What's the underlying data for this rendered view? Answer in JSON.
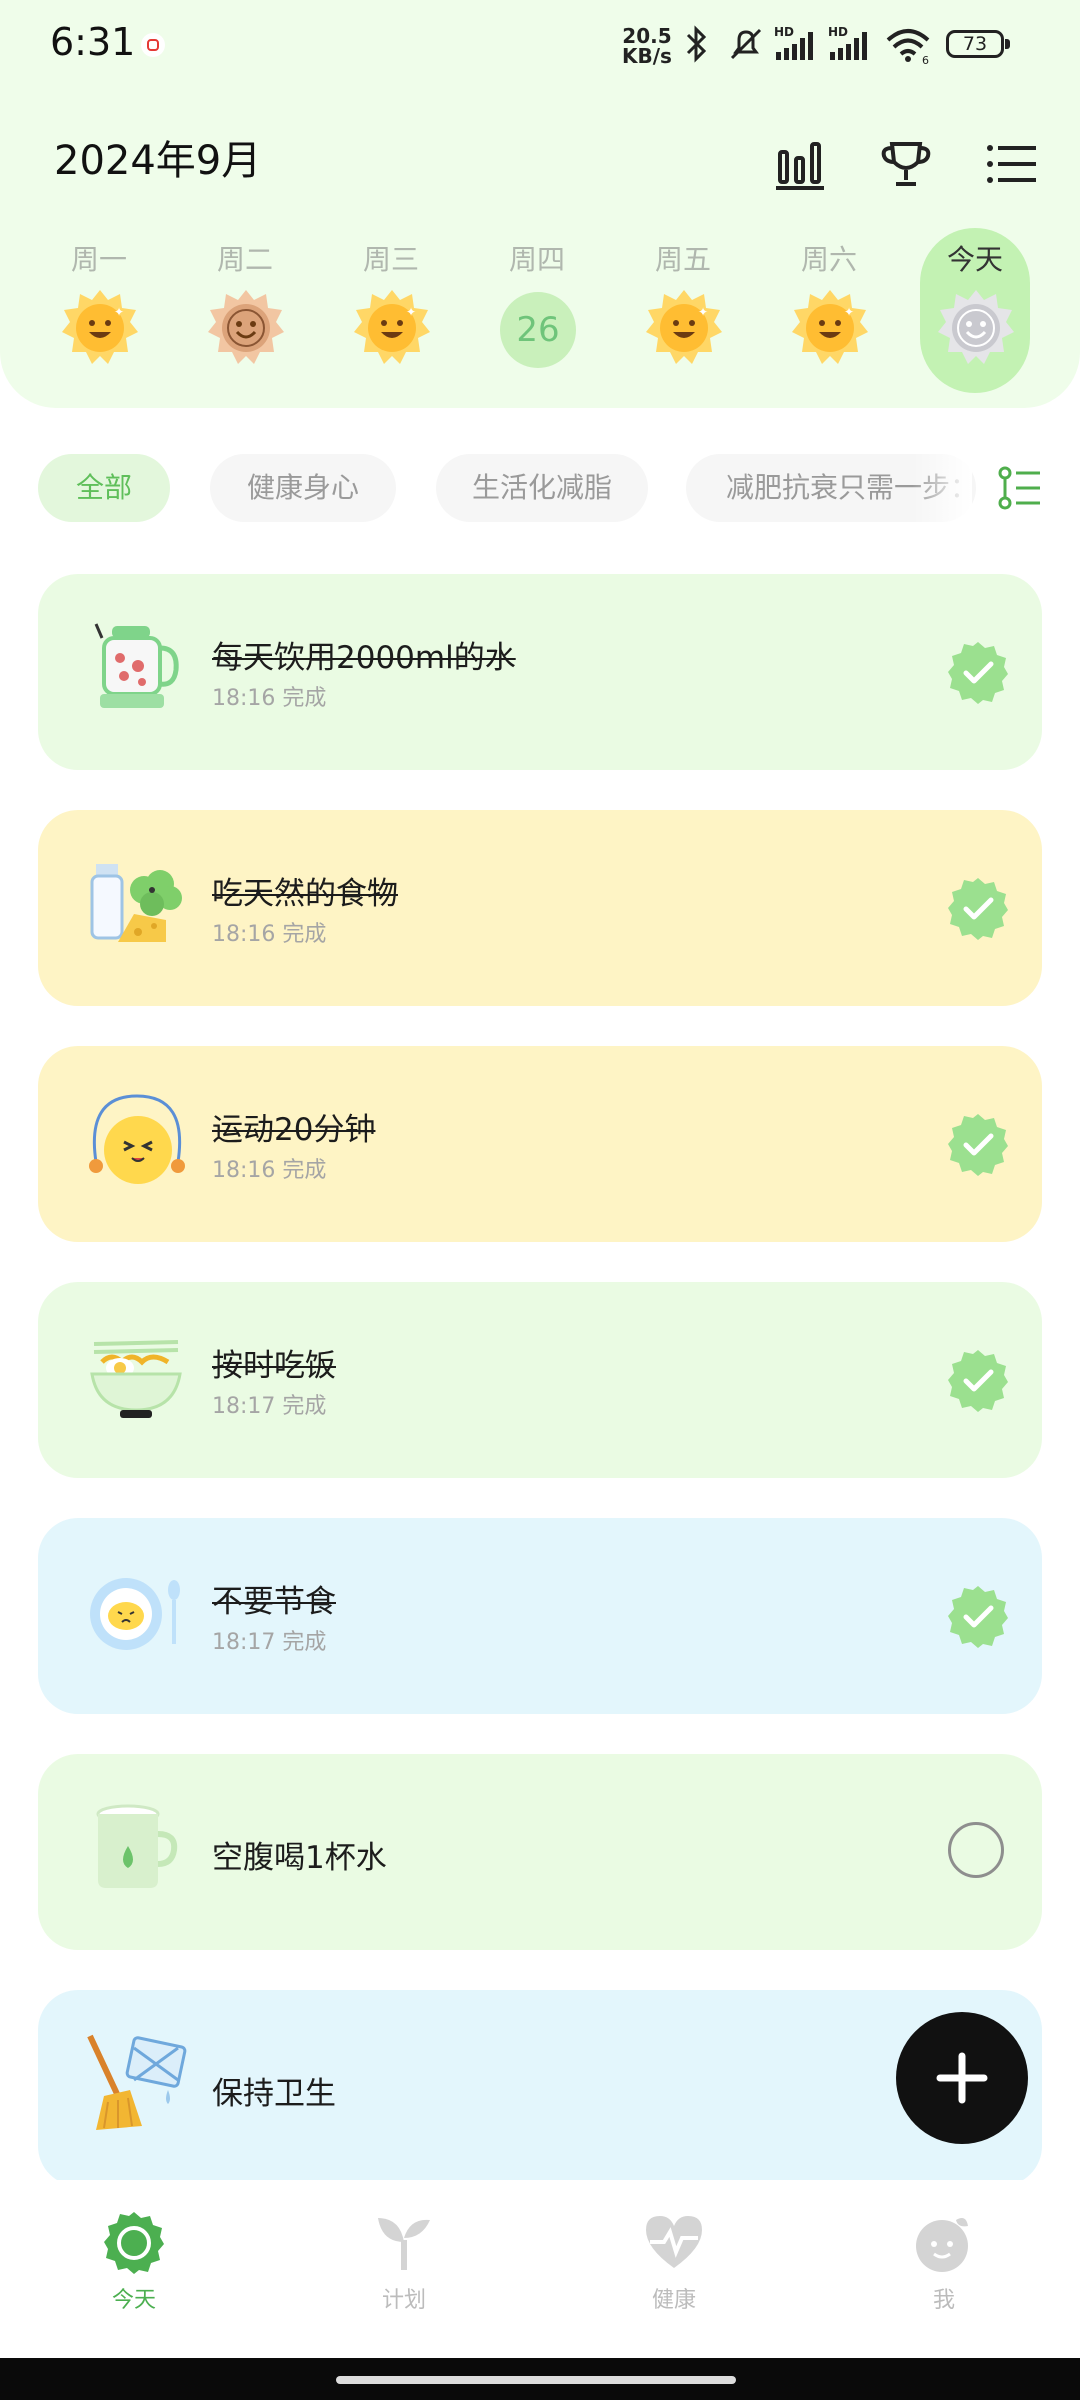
{
  "status_bar": {
    "time": "6:31",
    "net_speed_value": "20.5",
    "net_speed_unit": "KB/s",
    "signal_hd_1": "HD",
    "signal_hd_2": "HD",
    "wifi_sub": "6",
    "battery": "73"
  },
  "header": {
    "month": "2024年9月",
    "icons": [
      "stats-icon",
      "trophy-icon",
      "menu-icon"
    ]
  },
  "week": [
    {
      "label": "周一",
      "state": "happy"
    },
    {
      "label": "周二",
      "state": "bronze"
    },
    {
      "label": "周三",
      "state": "happy"
    },
    {
      "label": "周四",
      "date": "26",
      "state": "empty"
    },
    {
      "label": "周五",
      "state": "happy"
    },
    {
      "label": "周六",
      "state": "happy"
    },
    {
      "label": "今天",
      "state": "grey",
      "today": true
    }
  ],
  "filters": {
    "chips": [
      "全部",
      "健康身心",
      "生活化减脂",
      "减肥抗衰只需一步：控"
    ],
    "active_index": 0
  },
  "tasks": [
    {
      "title": "每天饮用2000ml的水",
      "time": "18:16",
      "status": "完成",
      "done": true,
      "color": "green",
      "icon": "kettle-icon"
    },
    {
      "title": "吃天然的食物",
      "time": "18:16",
      "status": "完成",
      "done": true,
      "color": "yellow",
      "icon": "milk-broccoli-cheese-icon"
    },
    {
      "title": "运动20分钟",
      "time": "18:16",
      "status": "完成",
      "done": true,
      "color": "yellow",
      "icon": "jump-rope-icon"
    },
    {
      "title": "按时吃饭",
      "time": "18:17",
      "status": "完成",
      "done": true,
      "color": "green",
      "icon": "rice-bowl-icon"
    },
    {
      "title": "不要节食",
      "time": "18:17",
      "status": "完成",
      "done": true,
      "color": "blue",
      "icon": "plate-spoon-icon"
    },
    {
      "title": "空腹喝1杯水",
      "done": false,
      "color": "green",
      "icon": "cup-icon"
    },
    {
      "title": "保持卫生",
      "done": false,
      "color": "blue",
      "icon": "broom-icon"
    }
  ],
  "bottom_nav": [
    {
      "label": "今天",
      "active": true,
      "icon": "sun-badge-icon"
    },
    {
      "label": "计划",
      "active": false,
      "icon": "sprout-icon"
    },
    {
      "label": "健康",
      "active": false,
      "icon": "heart-pulse-icon"
    },
    {
      "label": "我",
      "active": false,
      "icon": "profile-icon"
    }
  ],
  "colors": {
    "accent_green": "#5fbf5a",
    "card_green": "#eafbe3",
    "card_yellow": "#fef4c5",
    "card_blue": "#e3f6fc",
    "header_bg": "#effdea"
  }
}
